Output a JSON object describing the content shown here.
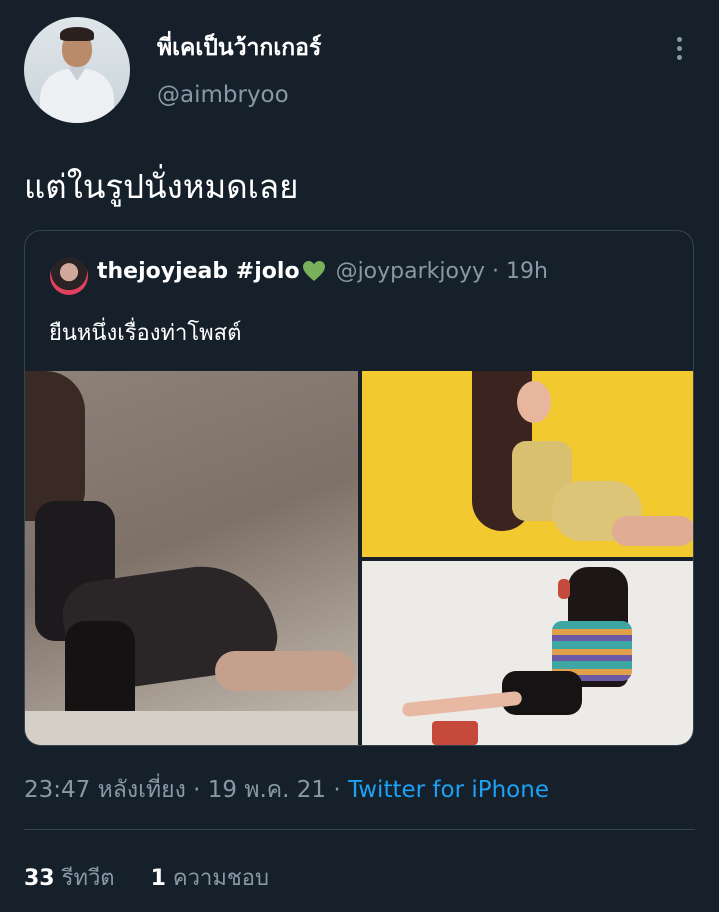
{
  "tweet": {
    "author": {
      "display_name": "พี่เคเป็นว้ากเกอร์",
      "handle": "@aimbryoo"
    },
    "text": "แต่ในรูปนั่งหมดเลย",
    "timestamp": "23:47 หลังเที่ยง · 19 พ.ค. 21 · ",
    "source": "Twitter for iPhone",
    "stats": {
      "retweets_count": "33",
      "retweets_label": "รีทวีต",
      "likes_count": "1",
      "likes_label": "ความชอบ"
    }
  },
  "quoted_tweet": {
    "display_name": "thejoyjeab #jolo",
    "handle": "@joyparkjoyy",
    "time": " · 19h",
    "text": "ยืนหนึ่งเรื่องท่าโพสต์",
    "photos": [
      "photo-1",
      "photo-2",
      "photo-3"
    ],
    "heart_color": "#78b159"
  },
  "icons": {
    "more": "more-vertical-icon",
    "heart": "green-heart-emoji"
  },
  "colors": {
    "background": "#15202b",
    "secondary_text": "#8899a6",
    "link": "#1da1f2",
    "border": "#38444d"
  }
}
